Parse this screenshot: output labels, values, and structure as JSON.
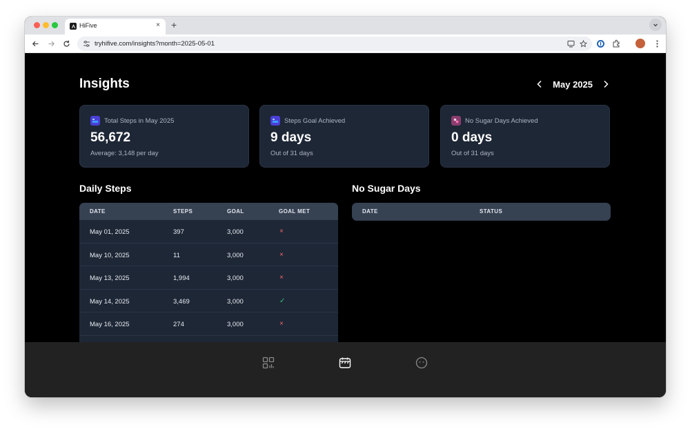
{
  "browser": {
    "tab_title": "HiFive",
    "tab_close": "×",
    "new_tab": "+",
    "url": "tryhifive.com/insights?month=2025-05-01"
  },
  "header": {
    "title": "Insights",
    "month": "May 2025"
  },
  "cards": [
    {
      "label": "Total Steps in May 2025",
      "value": "56,672",
      "sub": "Average: 3,148 per day",
      "icon": "steps-icon"
    },
    {
      "label": "Steps Goal Achieved",
      "value": "9 days",
      "sub": "Out of 31 days",
      "icon": "steps-goal-icon"
    },
    {
      "label": "No Sugar Days Achieved",
      "value": "0 days",
      "sub": "Out of 31 days",
      "icon": "no-sugar-icon"
    }
  ],
  "daily_steps": {
    "title": "Daily Steps",
    "columns": [
      "DATE",
      "STEPS",
      "GOAL",
      "GOAL MET"
    ],
    "rows": [
      {
        "date": "May 01, 2025",
        "steps": "397",
        "goal": "3,000",
        "met": "×"
      },
      {
        "date": "May 10, 2025",
        "steps": "11",
        "goal": "3,000",
        "met": "×"
      },
      {
        "date": "May 13, 2025",
        "steps": "1,994",
        "goal": "3,000",
        "met": "×"
      },
      {
        "date": "May 14, 2025",
        "steps": "3,469",
        "goal": "3,000",
        "met": "✓"
      },
      {
        "date": "May 16, 2025",
        "steps": "274",
        "goal": "3,000",
        "met": "×"
      }
    ]
  },
  "no_sugar_days": {
    "title": "No Sugar Days",
    "columns": [
      "DATE",
      "STATUS"
    ]
  },
  "bottom_nav": [
    "dashboard-icon",
    "calendar-icon",
    "face-icon"
  ],
  "colors": {
    "card_bg": "#1e2736",
    "table_header": "#364152",
    "goal_not_met": "#f0646a",
    "goal_met": "#34c77b"
  }
}
